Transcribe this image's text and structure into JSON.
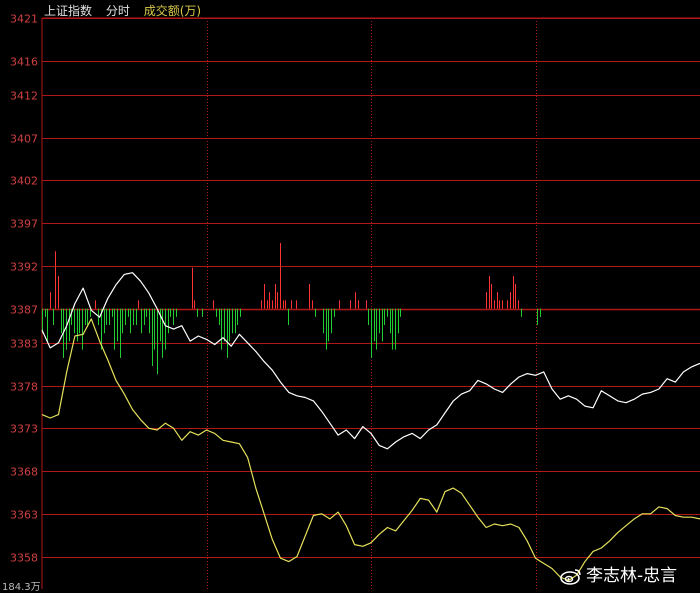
{
  "header": {
    "index_name": "上证指数",
    "period": "分时",
    "volume_label": "成交额(万)"
  },
  "watermark": {
    "text": "李志林-忠言",
    "icon": "weibo-icon"
  },
  "volume_scale_label": "184.3万",
  "colors": {
    "background": "#000000",
    "grid": "#b01818",
    "price_line": "#ffffff",
    "avg_line": "#e6e05a",
    "volume_up": "#ff3333",
    "volume_down": "#22cc33",
    "axis_text": "#d04040"
  },
  "chart_data": {
    "type": "line",
    "y_ticks": [
      3421,
      3416,
      3412,
      3407,
      3402,
      3397,
      3392,
      3387,
      3383,
      3378,
      3373,
      3368,
      3363,
      3358
    ],
    "ylim": [
      3354,
      3421
    ],
    "baseline": 3387,
    "x_range": [
      0,
      240
    ],
    "series": [
      {
        "role": "price",
        "points": [
          [
            0,
            3384.5
          ],
          [
            3,
            3382.4
          ],
          [
            6,
            3383.0
          ],
          [
            9,
            3385.0
          ],
          [
            12,
            3387.6
          ],
          [
            15,
            3389.4
          ],
          [
            18,
            3386.8
          ],
          [
            21,
            3386.0
          ],
          [
            24,
            3388.2
          ],
          [
            27,
            3389.8
          ],
          [
            30,
            3391.0
          ],
          [
            33,
            3391.2
          ],
          [
            36,
            3390.2
          ],
          [
            39,
            3388.8
          ],
          [
            42,
            3387.0
          ],
          [
            45,
            3385.0
          ],
          [
            48,
            3384.6
          ],
          [
            51,
            3385.0
          ],
          [
            54,
            3383.2
          ],
          [
            57,
            3383.8
          ],
          [
            60,
            3383.4
          ],
          [
            63,
            3382.8
          ],
          [
            66,
            3383.6
          ],
          [
            69,
            3382.6
          ],
          [
            72,
            3384.0
          ],
          [
            75,
            3383.0
          ],
          [
            78,
            3382.0
          ],
          [
            81,
            3380.8
          ],
          [
            84,
            3379.8
          ],
          [
            87,
            3378.4
          ],
          [
            90,
            3377.2
          ],
          [
            93,
            3376.8
          ],
          [
            96,
            3376.6
          ],
          [
            99,
            3376.2
          ],
          [
            102,
            3375.0
          ],
          [
            105,
            3373.6
          ],
          [
            108,
            3372.2
          ],
          [
            111,
            3372.8
          ],
          [
            114,
            3371.8
          ],
          [
            117,
            3373.2
          ],
          [
            120,
            3372.4
          ],
          [
            123,
            3371.0
          ],
          [
            126,
            3370.6
          ],
          [
            129,
            3371.4
          ],
          [
            132,
            3372.0
          ],
          [
            135,
            3372.4
          ],
          [
            138,
            3371.8
          ],
          [
            141,
            3372.8
          ],
          [
            144,
            3373.4
          ],
          [
            147,
            3374.8
          ],
          [
            150,
            3376.2
          ],
          [
            153,
            3377.0
          ],
          [
            156,
            3377.4
          ],
          [
            159,
            3378.6
          ],
          [
            162,
            3378.2
          ],
          [
            165,
            3377.6
          ],
          [
            168,
            3377.2
          ],
          [
            171,
            3378.2
          ],
          [
            174,
            3379.0
          ],
          [
            177,
            3379.4
          ],
          [
            180,
            3379.2
          ],
          [
            183,
            3379.6
          ],
          [
            186,
            3377.6
          ],
          [
            189,
            3376.4
          ],
          [
            192,
            3376.8
          ],
          [
            195,
            3376.4
          ],
          [
            198,
            3375.6
          ],
          [
            201,
            3375.4
          ],
          [
            204,
            3377.4
          ],
          [
            207,
            3376.8
          ],
          [
            210,
            3376.2
          ],
          [
            213,
            3376.0
          ],
          [
            216,
            3376.4
          ],
          [
            219,
            3377.0
          ],
          [
            222,
            3377.2
          ],
          [
            225,
            3377.6
          ],
          [
            228,
            3378.8
          ],
          [
            231,
            3378.4
          ],
          [
            234,
            3379.6
          ],
          [
            237,
            3380.2
          ],
          [
            240,
            3380.6
          ]
        ]
      },
      {
        "role": "average",
        "points": [
          [
            0,
            3374.6
          ],
          [
            3,
            3374.2
          ],
          [
            6,
            3374.6
          ],
          [
            9,
            3379.6
          ],
          [
            12,
            3383.8
          ],
          [
            15,
            3384.0
          ],
          [
            18,
            3385.8
          ],
          [
            21,
            3383.2
          ],
          [
            24,
            3381.0
          ],
          [
            27,
            3378.6
          ],
          [
            30,
            3377.0
          ],
          [
            33,
            3375.2
          ],
          [
            36,
            3374.0
          ],
          [
            39,
            3373.0
          ],
          [
            42,
            3372.8
          ],
          [
            45,
            3373.6
          ],
          [
            48,
            3373.0
          ],
          [
            51,
            3371.6
          ],
          [
            54,
            3372.6
          ],
          [
            57,
            3372.2
          ],
          [
            60,
            3372.8
          ],
          [
            63,
            3372.4
          ],
          [
            66,
            3371.6
          ],
          [
            69,
            3371.4
          ],
          [
            72,
            3371.2
          ],
          [
            75,
            3369.6
          ],
          [
            78,
            3366.0
          ],
          [
            81,
            3363.0
          ],
          [
            84,
            3360.0
          ],
          [
            87,
            3357.8
          ],
          [
            90,
            3357.4
          ],
          [
            93,
            3358.0
          ],
          [
            96,
            3360.4
          ],
          [
            99,
            3362.8
          ],
          [
            102,
            3363.0
          ],
          [
            105,
            3362.4
          ],
          [
            108,
            3363.2
          ],
          [
            111,
            3361.6
          ],
          [
            114,
            3359.4
          ],
          [
            117,
            3359.2
          ],
          [
            120,
            3359.6
          ],
          [
            123,
            3360.6
          ],
          [
            126,
            3361.4
          ],
          [
            129,
            3361.0
          ],
          [
            132,
            3362.2
          ],
          [
            135,
            3363.4
          ],
          [
            138,
            3364.8
          ],
          [
            141,
            3364.6
          ],
          [
            144,
            3363.2
          ],
          [
            147,
            3365.6
          ],
          [
            150,
            3366.0
          ],
          [
            153,
            3365.4
          ],
          [
            156,
            3364.0
          ],
          [
            159,
            3362.6
          ],
          [
            162,
            3361.4
          ],
          [
            165,
            3361.8
          ],
          [
            168,
            3361.6
          ],
          [
            171,
            3361.8
          ],
          [
            174,
            3361.4
          ],
          [
            177,
            3359.8
          ],
          [
            180,
            3357.8
          ],
          [
            183,
            3357.2
          ],
          [
            186,
            3356.6
          ],
          [
            189,
            3355.6
          ],
          [
            192,
            3355.2
          ],
          [
            195,
            3355.8
          ],
          [
            198,
            3357.4
          ],
          [
            201,
            3358.6
          ],
          [
            204,
            3359.0
          ],
          [
            207,
            3359.8
          ],
          [
            210,
            3360.8
          ],
          [
            213,
            3361.6
          ],
          [
            216,
            3362.4
          ],
          [
            219,
            3363.0
          ],
          [
            222,
            3363.0
          ],
          [
            225,
            3363.8
          ],
          [
            228,
            3363.6
          ],
          [
            231,
            3362.8
          ],
          [
            234,
            3362.6
          ],
          [
            237,
            3362.6
          ],
          [
            240,
            3362.4
          ]
        ]
      },
      {
        "role": "volume",
        "values": [
          -3,
          -1,
          -4,
          2,
          -2,
          7,
          4,
          -3,
          -6,
          -5,
          -4,
          -2,
          -3,
          -4,
          -3,
          -5,
          -2,
          -2,
          -1,
          0,
          1,
          -2,
          -5,
          -3,
          -2,
          -2,
          -1,
          -5,
          -4,
          -6,
          -3,
          -2,
          -1,
          -3,
          -2,
          -2,
          1,
          -3,
          -2,
          -1,
          -3,
          -7,
          -5,
          -8,
          -4,
          -6,
          -5,
          -3,
          -1,
          -2,
          -1,
          0,
          0,
          0,
          0,
          0,
          5,
          1,
          -1,
          0,
          -1,
          0,
          0,
          0,
          1,
          -1,
          -2,
          -5,
          -4,
          -6,
          -4,
          -3,
          -3,
          -2,
          -1,
          0,
          0,
          0,
          0,
          0,
          0,
          0,
          1,
          3,
          1,
          2,
          1,
          3,
          2,
          8,
          1,
          1,
          -2,
          1,
          0,
          1,
          0,
          0,
          0,
          0,
          3,
          1,
          -1,
          0,
          0,
          -3,
          -5,
          -4,
          -3,
          -1,
          0,
          1,
          0,
          0,
          0,
          1,
          0,
          2,
          1,
          0,
          0,
          1,
          -2,
          -6,
          -4,
          -5,
          -3,
          -4,
          -2,
          -1,
          -3,
          -5,
          -5,
          -3,
          -1,
          0,
          0,
          0,
          0,
          0,
          0,
          0,
          0,
          0,
          0,
          0,
          0,
          0,
          0,
          0,
          0,
          0,
          0,
          0,
          0,
          0,
          0,
          0,
          0,
          0,
          0,
          0,
          0,
          0,
          0,
          0,
          2,
          4,
          3,
          1,
          2,
          1,
          1,
          0,
          1,
          2,
          4,
          3,
          1,
          -1,
          0,
          0,
          0,
          0,
          0,
          -2,
          -1,
          0,
          0,
          0,
          0,
          0,
          0,
          0,
          0,
          0,
          0,
          0,
          0,
          0,
          0,
          0,
          0,
          0,
          0,
          0,
          0,
          0,
          0,
          0,
          0,
          0,
          0,
          0,
          0,
          0,
          0,
          0,
          0,
          0,
          0,
          0,
          0,
          0,
          0,
          0,
          0,
          0,
          0,
          0,
          0,
          0,
          0,
          0,
          0,
          0,
          0,
          0,
          0,
          0,
          0,
          0,
          0,
          0,
          0,
          0
        ]
      }
    ]
  }
}
